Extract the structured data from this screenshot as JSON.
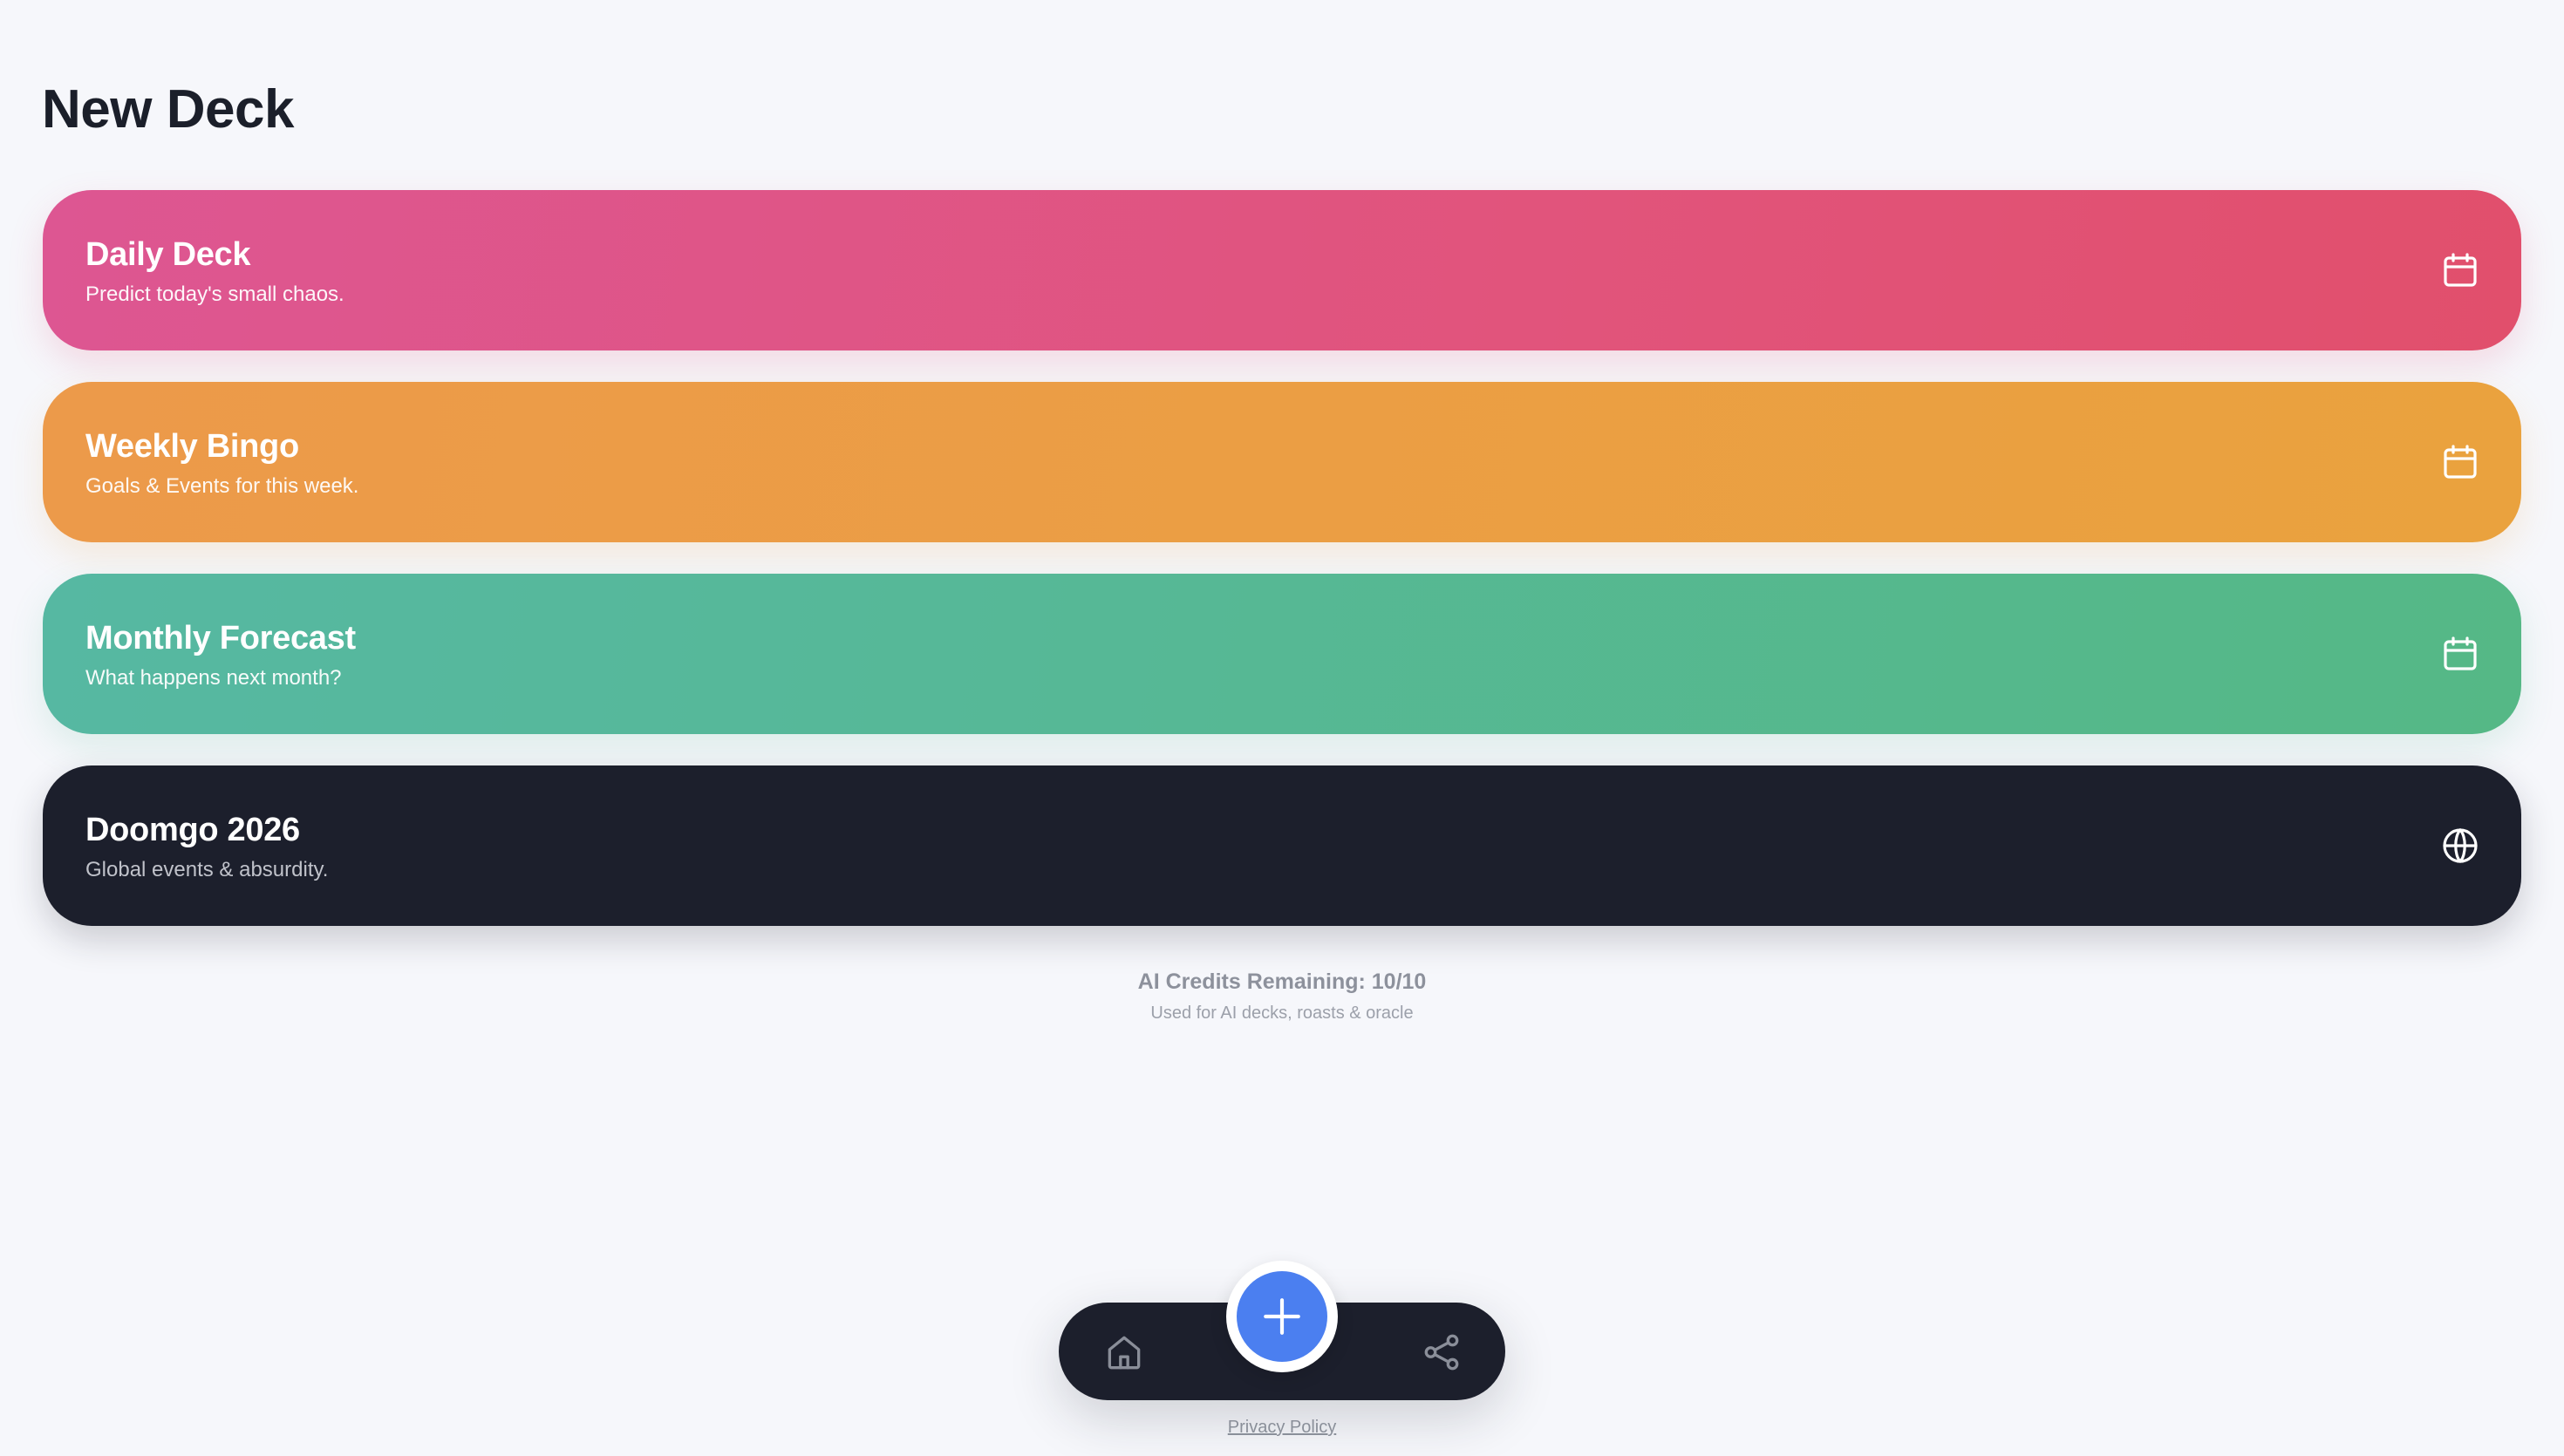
{
  "page": {
    "title": "New Deck"
  },
  "decks": [
    {
      "title": "Daily Deck",
      "subtitle": "Predict today's small chaos.",
      "icon": "calendar-icon",
      "color": "#e1547c"
    },
    {
      "title": "Weekly Bingo",
      "subtitle": "Goals & Events for this week.",
      "icon": "calendar-icon",
      "color": "#eaa23e"
    },
    {
      "title": "Monthly Forecast",
      "subtitle": "What happens next month?",
      "icon": "calendar-icon",
      "color": "#55b88f"
    },
    {
      "title": "Doomgo 2026",
      "subtitle": "Global events & absurdity.",
      "icon": "globe-icon",
      "color": "#1c1f2c"
    }
  ],
  "credits": {
    "title": "AI Credits Remaining: 10/10",
    "subtitle": "Used for AI decks, roasts & oracle"
  },
  "bottom_nav": {
    "home_icon": "home-icon",
    "add_icon": "plus-icon",
    "share_icon": "share-icon",
    "accent": "#4b7ff0"
  },
  "footer": {
    "privacy_label": "Privacy Policy"
  }
}
